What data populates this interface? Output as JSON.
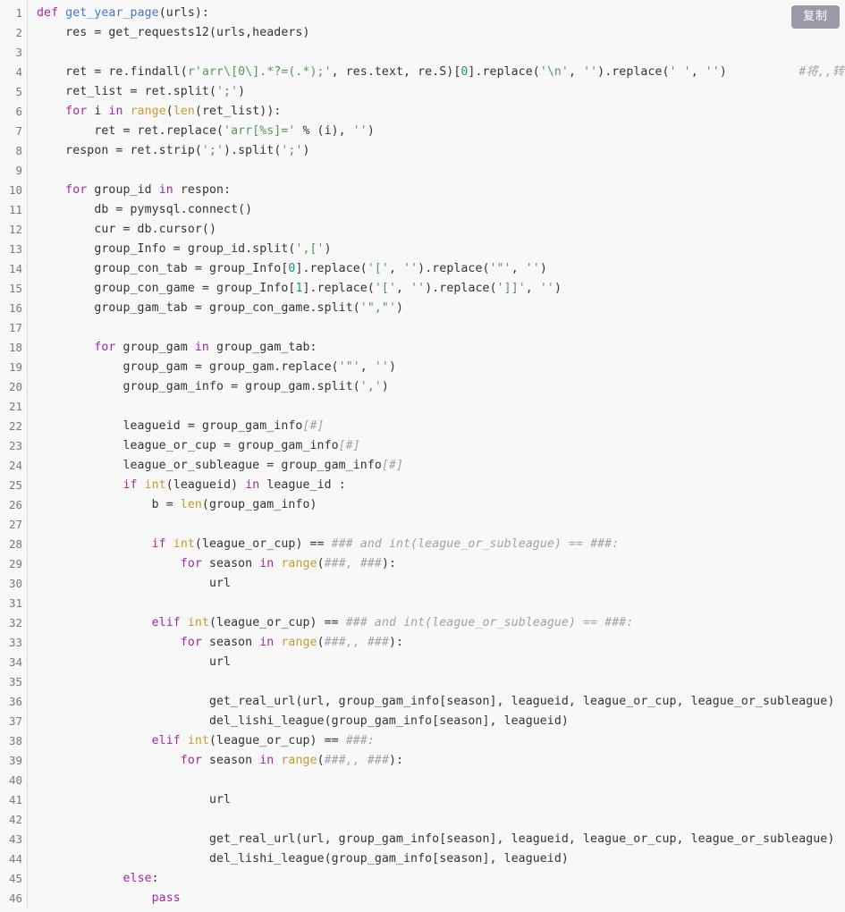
{
  "toolbar": {
    "copy_label": "复制"
  },
  "editor": {
    "language": "python",
    "colors": {
      "background": "#f8f8f8",
      "keyword": "#a626a4",
      "function": "#4078c8",
      "builtin": "#c89b2a",
      "string": "#4f9a58",
      "comment": "#a0a1a7",
      "text": "#333333",
      "gutter_text": "#7a7a7a",
      "copy_button_bg": "#9a9aa8"
    },
    "first_line_number": 1,
    "last_line_number": 46,
    "line_numbers": [
      1,
      2,
      3,
      4,
      5,
      6,
      7,
      8,
      9,
      10,
      11,
      12,
      13,
      14,
      15,
      16,
      17,
      18,
      19,
      20,
      21,
      22,
      23,
      24,
      25,
      26,
      27,
      28,
      29,
      30,
      31,
      32,
      33,
      34,
      35,
      36,
      37,
      38,
      39,
      40,
      41,
      42,
      43,
      44,
      45,
      46
    ],
    "lines": [
      {
        "n": 1,
        "tokens": [
          {
            "t": "def",
            "c": "kw"
          },
          {
            "t": " ",
            "c": "txt"
          },
          {
            "t": "get_year_page",
            "c": "fn"
          },
          {
            "t": "(urls):",
            "c": "txt"
          }
        ]
      },
      {
        "n": 2,
        "tokens": [
          {
            "t": "    res = get_requests12(urls,headers)",
            "c": "txt"
          }
        ]
      },
      {
        "n": 3,
        "tokens": []
      },
      {
        "n": 4,
        "tokens": [
          {
            "t": "    ret = re.findall(",
            "c": "txt"
          },
          {
            "t": "r'arr\\[0\\].*?=(.*);'",
            "c": "str"
          },
          {
            "t": ", res.text, re.S)[",
            "c": "txt"
          },
          {
            "t": "0",
            "c": "num"
          },
          {
            "t": "].replace(",
            "c": "txt"
          },
          {
            "t": "'\\n'",
            "c": "str"
          },
          {
            "t": ", ",
            "c": "txt"
          },
          {
            "t": "''",
            "c": "str"
          },
          {
            "t": ").replace(",
            "c": "txt"
          },
          {
            "t": "' '",
            "c": "str"
          },
          {
            "t": ", ",
            "c": "txt"
          },
          {
            "t": "''",
            "c": "str"
          },
          {
            "t": ")",
            "c": "txt"
          },
          {
            "t": "          #将,,转为'',",
            "c": "cmt"
          }
        ]
      },
      {
        "n": 5,
        "tokens": [
          {
            "t": "    ret_list = ret.split(",
            "c": "txt"
          },
          {
            "t": "';'",
            "c": "str"
          },
          {
            "t": ")",
            "c": "txt"
          }
        ]
      },
      {
        "n": 6,
        "tokens": [
          {
            "t": "    ",
            "c": "txt"
          },
          {
            "t": "for",
            "c": "kw"
          },
          {
            "t": " i ",
            "c": "txt"
          },
          {
            "t": "in",
            "c": "kw"
          },
          {
            "t": " ",
            "c": "txt"
          },
          {
            "t": "range",
            "c": "bi"
          },
          {
            "t": "(",
            "c": "txt"
          },
          {
            "t": "len",
            "c": "bi"
          },
          {
            "t": "(ret_list)):",
            "c": "txt"
          }
        ]
      },
      {
        "n": 7,
        "tokens": [
          {
            "t": "        ret = ret.replace(",
            "c": "txt"
          },
          {
            "t": "'arr[%s]='",
            "c": "str"
          },
          {
            "t": " % (i), ",
            "c": "txt"
          },
          {
            "t": "''",
            "c": "str"
          },
          {
            "t": ")",
            "c": "txt"
          }
        ]
      },
      {
        "n": 8,
        "tokens": [
          {
            "t": "    respon = ret.strip(",
            "c": "txt"
          },
          {
            "t": "';'",
            "c": "str"
          },
          {
            "t": ").split(",
            "c": "txt"
          },
          {
            "t": "';'",
            "c": "str"
          },
          {
            "t": ")",
            "c": "txt"
          }
        ]
      },
      {
        "n": 9,
        "tokens": []
      },
      {
        "n": 10,
        "tokens": [
          {
            "t": "    ",
            "c": "txt"
          },
          {
            "t": "for",
            "c": "kw"
          },
          {
            "t": " group_id ",
            "c": "txt"
          },
          {
            "t": "in",
            "c": "kw"
          },
          {
            "t": " respon:",
            "c": "txt"
          }
        ]
      },
      {
        "n": 11,
        "tokens": [
          {
            "t": "        db = pymysql.connect()",
            "c": "txt"
          }
        ]
      },
      {
        "n": 12,
        "tokens": [
          {
            "t": "        cur = db.cursor()",
            "c": "txt"
          }
        ]
      },
      {
        "n": 13,
        "tokens": [
          {
            "t": "        group_Info = group_id.split(",
            "c": "txt"
          },
          {
            "t": "',['",
            "c": "str"
          },
          {
            "t": ")",
            "c": "txt"
          }
        ]
      },
      {
        "n": 14,
        "tokens": [
          {
            "t": "        group_con_tab = group_Info[",
            "c": "txt"
          },
          {
            "t": "0",
            "c": "num"
          },
          {
            "t": "].replace(",
            "c": "txt"
          },
          {
            "t": "'['",
            "c": "str"
          },
          {
            "t": ", ",
            "c": "txt"
          },
          {
            "t": "''",
            "c": "str"
          },
          {
            "t": ").replace(",
            "c": "txt"
          },
          {
            "t": "'\"'",
            "c": "str"
          },
          {
            "t": ", ",
            "c": "txt"
          },
          {
            "t": "''",
            "c": "str"
          },
          {
            "t": ")",
            "c": "txt"
          }
        ]
      },
      {
        "n": 15,
        "tokens": [
          {
            "t": "        group_con_game = group_Info[",
            "c": "txt"
          },
          {
            "t": "1",
            "c": "num"
          },
          {
            "t": "].replace(",
            "c": "txt"
          },
          {
            "t": "'['",
            "c": "str"
          },
          {
            "t": ", ",
            "c": "txt"
          },
          {
            "t": "''",
            "c": "str"
          },
          {
            "t": ").replace(",
            "c": "txt"
          },
          {
            "t": "']]'",
            "c": "str"
          },
          {
            "t": ", ",
            "c": "txt"
          },
          {
            "t": "''",
            "c": "str"
          },
          {
            "t": ")",
            "c": "txt"
          }
        ]
      },
      {
        "n": 16,
        "tokens": [
          {
            "t": "        group_gam_tab = group_con_game.split(",
            "c": "txt"
          },
          {
            "t": "'\",\"'",
            "c": "str"
          },
          {
            "t": ")",
            "c": "txt"
          }
        ]
      },
      {
        "n": 17,
        "tokens": []
      },
      {
        "n": 18,
        "tokens": [
          {
            "t": "        ",
            "c": "txt"
          },
          {
            "t": "for",
            "c": "kw"
          },
          {
            "t": " group_gam ",
            "c": "txt"
          },
          {
            "t": "in",
            "c": "kw"
          },
          {
            "t": " group_gam_tab:",
            "c": "txt"
          }
        ]
      },
      {
        "n": 19,
        "tokens": [
          {
            "t": "            group_gam = group_gam.replace(",
            "c": "txt"
          },
          {
            "t": "'\"'",
            "c": "str"
          },
          {
            "t": ", ",
            "c": "txt"
          },
          {
            "t": "''",
            "c": "str"
          },
          {
            "t": ")",
            "c": "txt"
          }
        ]
      },
      {
        "n": 20,
        "tokens": [
          {
            "t": "            group_gam_info = group_gam.split(",
            "c": "txt"
          },
          {
            "t": "','",
            "c": "str"
          },
          {
            "t": ")",
            "c": "txt"
          }
        ]
      },
      {
        "n": 21,
        "tokens": []
      },
      {
        "n": 22,
        "tokens": [
          {
            "t": "            leagueid = group_gam_info",
            "c": "txt"
          },
          {
            "t": "[#]",
            "c": "cmt"
          }
        ]
      },
      {
        "n": 23,
        "tokens": [
          {
            "t": "            league_or_cup = group_gam_info",
            "c": "txt"
          },
          {
            "t": "[#]",
            "c": "cmt"
          }
        ]
      },
      {
        "n": 24,
        "tokens": [
          {
            "t": "            league_or_subleague = group_gam_info",
            "c": "txt"
          },
          {
            "t": "[#]",
            "c": "cmt"
          }
        ]
      },
      {
        "n": 25,
        "tokens": [
          {
            "t": "            ",
            "c": "txt"
          },
          {
            "t": "if",
            "c": "kw"
          },
          {
            "t": " ",
            "c": "txt"
          },
          {
            "t": "int",
            "c": "bi"
          },
          {
            "t": "(leagueid) ",
            "c": "txt"
          },
          {
            "t": "in",
            "c": "kw"
          },
          {
            "t": " league_id :",
            "c": "txt"
          }
        ]
      },
      {
        "n": 26,
        "tokens": [
          {
            "t": "                b = ",
            "c": "txt"
          },
          {
            "t": "len",
            "c": "bi"
          },
          {
            "t": "(group_gam_info)",
            "c": "txt"
          }
        ]
      },
      {
        "n": 27,
        "tokens": []
      },
      {
        "n": 28,
        "tokens": [
          {
            "t": "                ",
            "c": "txt"
          },
          {
            "t": "if",
            "c": "kw"
          },
          {
            "t": " ",
            "c": "txt"
          },
          {
            "t": "int",
            "c": "bi"
          },
          {
            "t": "(league_or_cup) == ",
            "c": "txt"
          },
          {
            "t": "### and int(league_or_subleague) == ###:",
            "c": "cmt"
          }
        ]
      },
      {
        "n": 29,
        "tokens": [
          {
            "t": "                    ",
            "c": "txt"
          },
          {
            "t": "for",
            "c": "kw"
          },
          {
            "t": " season ",
            "c": "txt"
          },
          {
            "t": "in",
            "c": "kw"
          },
          {
            "t": " ",
            "c": "txt"
          },
          {
            "t": "range",
            "c": "bi"
          },
          {
            "t": "(",
            "c": "txt"
          },
          {
            "t": "###, ###",
            "c": "cmt"
          },
          {
            "t": "):",
            "c": "txt"
          }
        ]
      },
      {
        "n": 30,
        "tokens": [
          {
            "t": "                        url",
            "c": "txt"
          }
        ]
      },
      {
        "n": 31,
        "tokens": []
      },
      {
        "n": 32,
        "tokens": [
          {
            "t": "                ",
            "c": "txt"
          },
          {
            "t": "elif",
            "c": "kw"
          },
          {
            "t": " ",
            "c": "txt"
          },
          {
            "t": "int",
            "c": "bi"
          },
          {
            "t": "(league_or_cup) == ",
            "c": "txt"
          },
          {
            "t": "### and int(league_or_subleague) == ###:",
            "c": "cmt"
          }
        ]
      },
      {
        "n": 33,
        "tokens": [
          {
            "t": "                    ",
            "c": "txt"
          },
          {
            "t": "for",
            "c": "kw"
          },
          {
            "t": " season ",
            "c": "txt"
          },
          {
            "t": "in",
            "c": "kw"
          },
          {
            "t": " ",
            "c": "txt"
          },
          {
            "t": "range",
            "c": "bi"
          },
          {
            "t": "(",
            "c": "txt"
          },
          {
            "t": "###,, ###",
            "c": "cmt"
          },
          {
            "t": "):",
            "c": "txt"
          }
        ]
      },
      {
        "n": 34,
        "tokens": [
          {
            "t": "                        url",
            "c": "txt"
          }
        ]
      },
      {
        "n": 35,
        "tokens": []
      },
      {
        "n": 36,
        "tokens": [
          {
            "t": "                        get_real_url(url, group_gam_info[season], leagueid, league_or_cup, league_or_subleague)",
            "c": "txt"
          }
        ]
      },
      {
        "n": 37,
        "tokens": [
          {
            "t": "                        del_lishi_league(group_gam_info[season], leagueid)",
            "c": "txt"
          }
        ]
      },
      {
        "n": 38,
        "tokens": [
          {
            "t": "                ",
            "c": "txt"
          },
          {
            "t": "elif",
            "c": "kw"
          },
          {
            "t": " ",
            "c": "txt"
          },
          {
            "t": "int",
            "c": "bi"
          },
          {
            "t": "(league_or_cup) == ",
            "c": "txt"
          },
          {
            "t": "###:",
            "c": "cmt"
          }
        ]
      },
      {
        "n": 39,
        "tokens": [
          {
            "t": "                    ",
            "c": "txt"
          },
          {
            "t": "for",
            "c": "kw"
          },
          {
            "t": " season ",
            "c": "txt"
          },
          {
            "t": "in",
            "c": "kw"
          },
          {
            "t": " ",
            "c": "txt"
          },
          {
            "t": "range",
            "c": "bi"
          },
          {
            "t": "(",
            "c": "txt"
          },
          {
            "t": "###,, ###",
            "c": "cmt"
          },
          {
            "t": "):",
            "c": "txt"
          }
        ]
      },
      {
        "n": 40,
        "tokens": []
      },
      {
        "n": 41,
        "tokens": [
          {
            "t": "                        url",
            "c": "txt"
          }
        ]
      },
      {
        "n": 42,
        "tokens": []
      },
      {
        "n": 43,
        "tokens": [
          {
            "t": "                        get_real_url(url, group_gam_info[season], leagueid, league_or_cup, league_or_subleague)",
            "c": "txt"
          }
        ]
      },
      {
        "n": 44,
        "tokens": [
          {
            "t": "                        del_lishi_league(group_gam_info[season], leagueid)",
            "c": "txt"
          }
        ]
      },
      {
        "n": 45,
        "tokens": [
          {
            "t": "            ",
            "c": "txt"
          },
          {
            "t": "else",
            "c": "kw"
          },
          {
            "t": ":",
            "c": "txt"
          }
        ]
      },
      {
        "n": 46,
        "tokens": [
          {
            "t": "                ",
            "c": "txt"
          },
          {
            "t": "pass",
            "c": "kw"
          }
        ]
      }
    ]
  }
}
